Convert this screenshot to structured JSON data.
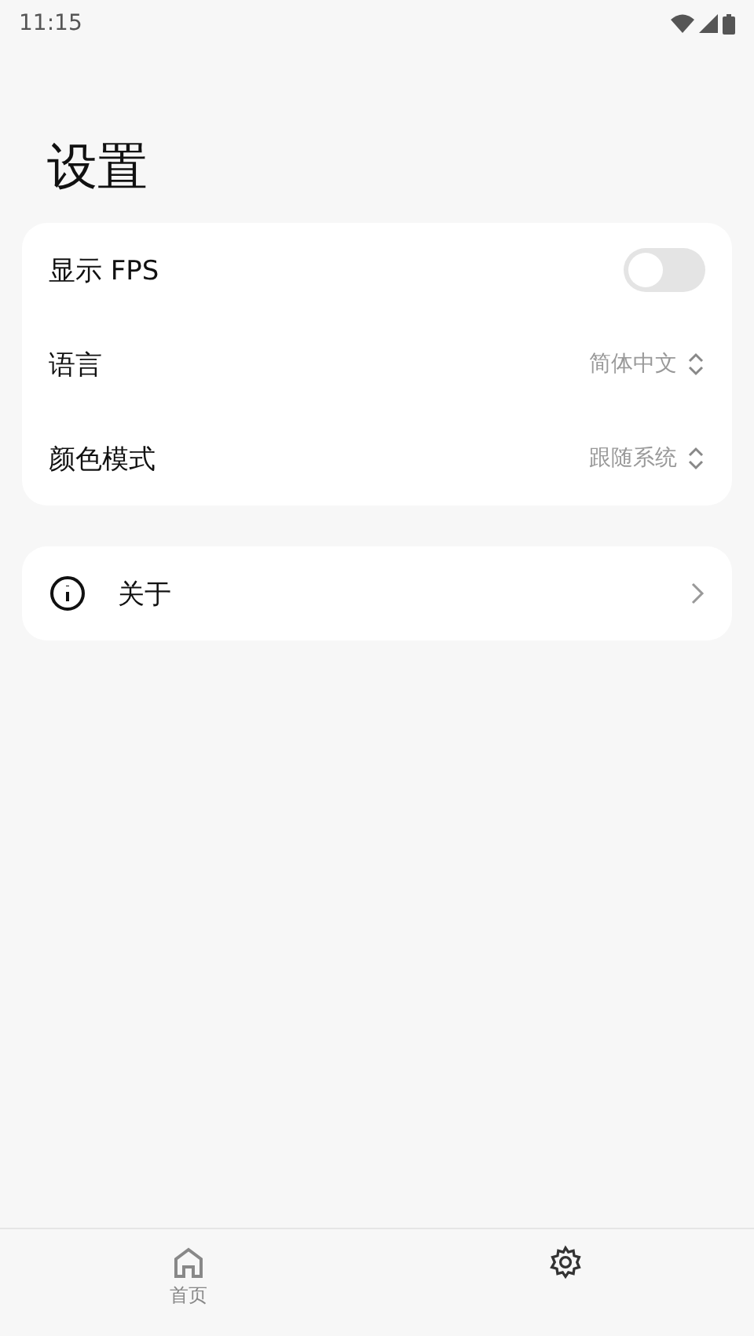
{
  "status_bar": {
    "time": "11:15"
  },
  "title": "设置",
  "settings": [
    {
      "kind": "toggle",
      "label": "显示 FPS",
      "on": false
    },
    {
      "kind": "select",
      "label": "语言",
      "value": "简体中文"
    },
    {
      "kind": "select",
      "label": "颜色模式",
      "value": "跟随系统"
    }
  ],
  "about": {
    "label": "关于"
  },
  "bottom_nav": [
    {
      "kind": "home",
      "label": "首页",
      "selected": false
    },
    {
      "kind": "settings",
      "selected": true
    }
  ]
}
